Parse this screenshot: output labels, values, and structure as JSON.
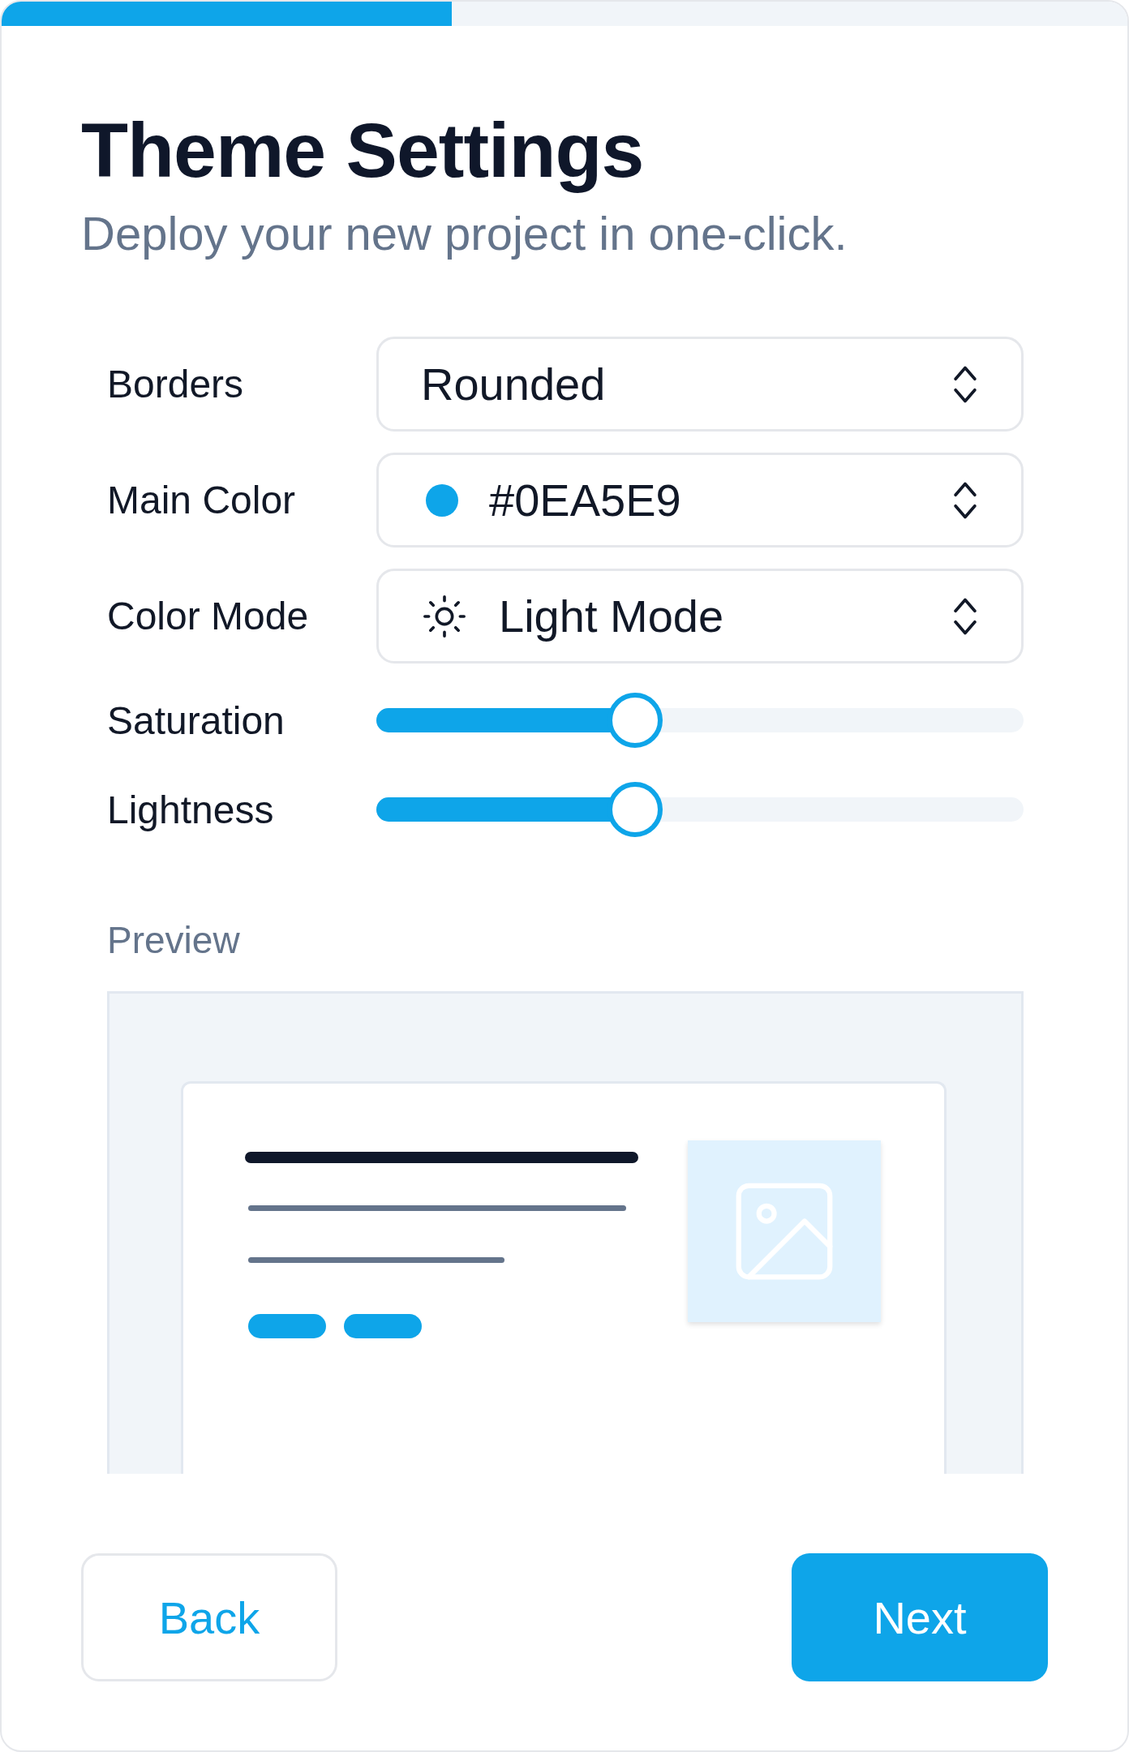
{
  "progress": {
    "level": 0.4
  },
  "title": "Theme Settings",
  "subtitle": "Deploy your new project in one-click.",
  "fields": [
    {
      "kind": "select",
      "label": "Borders",
      "value": "Rounded"
    },
    {
      "kind": "color",
      "label": "Main Color",
      "value": "#0EA5E9",
      "color": "#0ea5e9"
    },
    {
      "kind": "mode",
      "label": "Color Mode",
      "value": "Light Mode"
    },
    {
      "kind": "slider",
      "label": "Saturation",
      "level": 0.4
    },
    {
      "kind": "slider",
      "label": "Lightness",
      "level": 0.4
    }
  ],
  "preview": {
    "label": "Preview"
  },
  "buttons": {
    "back": "Back",
    "next": "Next"
  }
}
